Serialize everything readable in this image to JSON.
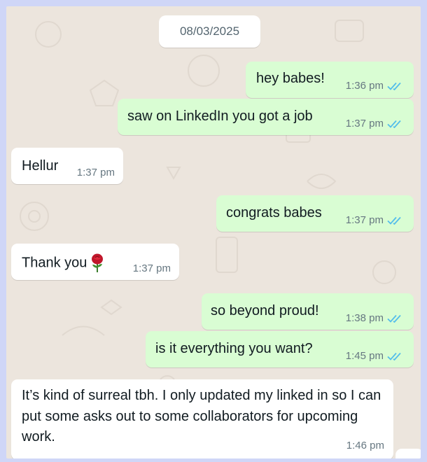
{
  "chat": {
    "date": "08/03/2025",
    "messages": [
      {
        "direction": "out",
        "text": "hey babes!",
        "time": "1:36 pm",
        "status": "read"
      },
      {
        "direction": "out",
        "text": "saw on LinkedIn you got a job",
        "time": "1:37 pm",
        "status": "read"
      },
      {
        "direction": "in",
        "text": "Hellur",
        "time": "1:37 pm"
      },
      {
        "direction": "out",
        "text": "congrats babes",
        "time": "1:37 pm",
        "status": "read"
      },
      {
        "direction": "in",
        "text": "Thank you",
        "emoji": "rose",
        "time": "1:37 pm"
      },
      {
        "direction": "out",
        "text": "so beyond proud!",
        "time": "1:38 pm",
        "status": "read"
      },
      {
        "direction": "out",
        "text": "is it everything you want?",
        "time": "1:45 pm",
        "status": "read"
      },
      {
        "direction": "in",
        "text": "It’s kind of surreal tbh. I only updated my linked in so I can put some asks out to some collaborators for upcoming work.",
        "time": "1:46 pm"
      }
    ]
  },
  "colors": {
    "outer_background": "#cfd6f7",
    "chat_background": "#ece5dd",
    "outgoing_bubble": "#d9fdd3",
    "incoming_bubble": "#ffffff",
    "read_ticks": "#53bdeb",
    "timestamp": "#667781"
  },
  "icons": {
    "read_receipt": "double-check-icon",
    "emoji": "rose-icon"
  }
}
